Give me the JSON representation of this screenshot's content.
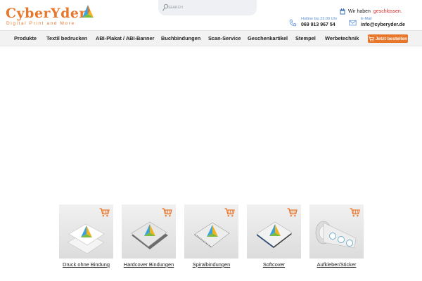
{
  "brand": {
    "name": "CyberYder",
    "tagline": "Digital Print and More",
    "accent_color": "#e8762b"
  },
  "search": {
    "placeholder": "SEARCH"
  },
  "status": {
    "prefix": "Wir haben",
    "state": "geschlossen.",
    "state_color": "#d62828"
  },
  "contact": {
    "hotline_label": "Hotline bis 23.00 Uhr",
    "hotline_number": "069 913 967 54",
    "email_label": "E-Mail",
    "email_address": "info@cyberyder.de"
  },
  "nav": {
    "items": [
      "Produkte",
      "Textil bedrucken",
      "ABI-Plakat / ABI-Banner",
      "Buchbindungen",
      "Scan-Service",
      "Geschenkartikel",
      "Stempel",
      "Werbetechnik"
    ],
    "order_button": "Jetzt bestellen"
  },
  "products": [
    {
      "label": "Druck ohne Bindung",
      "icon": "loose-sheets-icon"
    },
    {
      "label": "Hardcover Bindungen",
      "icon": "hardcover-book-icon"
    },
    {
      "label": "Spiralbindungen",
      "icon": "spiral-notebook-icon"
    },
    {
      "label": "Softcover",
      "icon": "softcover-book-icon"
    },
    {
      "label": "Aufkleber/Sticker",
      "icon": "sticker-roll-icon"
    }
  ]
}
